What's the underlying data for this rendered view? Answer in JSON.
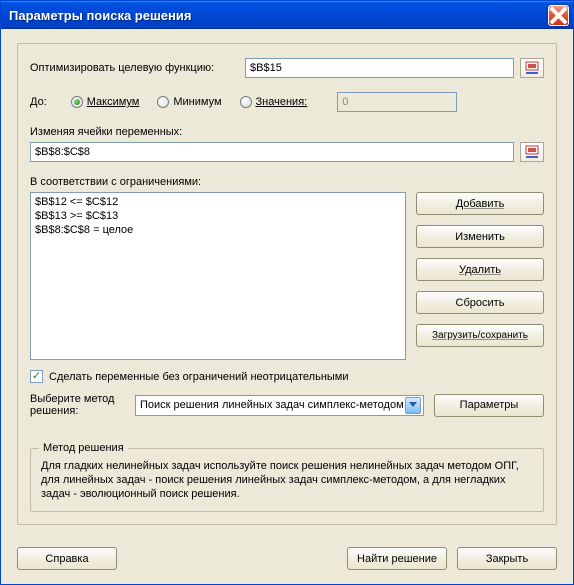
{
  "window": {
    "title": "Параметры поиска решения"
  },
  "objective": {
    "label": "Оптимизировать целевую функцию:",
    "value": "$B$15"
  },
  "to": {
    "label": "До:",
    "options": {
      "max": "Максимум",
      "min": "Минимум",
      "value": "Значения:"
    },
    "selected": "max",
    "value_input": "0"
  },
  "variables": {
    "label": "Изменяя ячейки переменных:",
    "value": "$B$8:$C$8"
  },
  "constraints": {
    "label": "В соответствии с ограничениями:",
    "items": [
      "$B$12 <= $C$12",
      "$B$13 >= $C$13",
      "$B$8:$C$8 = целое"
    ]
  },
  "buttons": {
    "add": "Добавить",
    "change": "Изменить",
    "delete": "Удалить",
    "reset": "Сбросить",
    "loadsave": "Загрузить/сохранить",
    "params": "Параметры",
    "help": "Справка",
    "solve": "Найти решение",
    "close": "Закрыть"
  },
  "nonneg": {
    "checked": true,
    "label": "Сделать переменные без ограничений неотрицательными"
  },
  "method": {
    "label": "Выберите метод решения:",
    "selected": "Поиск решения линейных задач симплекс-методом"
  },
  "method_fieldset": {
    "title": "Метод решения",
    "body": "Для гладких нелинейных задач используйте поиск решения нелинейных задач методом ОПГ, для линейных задач - поиск решения линейных задач симплекс-методом, а для негладких задач - эволюционный поиск решения."
  }
}
